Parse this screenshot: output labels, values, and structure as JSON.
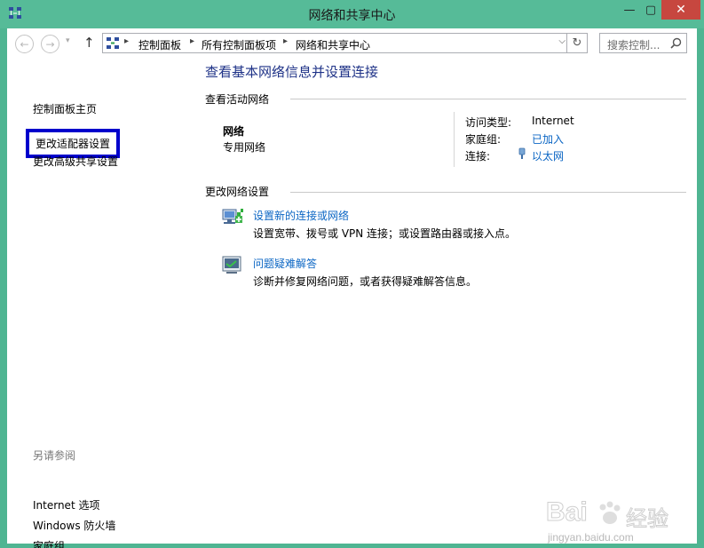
{
  "window": {
    "title": "网络和共享中心",
    "app_icon": "network-sharing-center-icon"
  },
  "titlebar_buttons": {
    "minimize": "—",
    "maximize": "▢",
    "close": "✕"
  },
  "navigation": {
    "back_glyph": "←",
    "forward_glyph": "→",
    "recent_glyph": "▾",
    "up_glyph": "↑",
    "breadcrumb": [
      "控制面板",
      "所有控制面板项",
      "网络和共享中心"
    ],
    "separator": "▸",
    "dropdown_glyph": "⌵",
    "refresh_glyph": "↻",
    "search_placeholder": "搜索控制..."
  },
  "sidebar": {
    "home": "控制面板主页",
    "change_adapter": "更改适配器设置",
    "change_sharing": "更改高级共享设置",
    "see_also": "另请参阅",
    "links": [
      "Internet 选项",
      "Windows 防火墙",
      "家庭组"
    ]
  },
  "main": {
    "title": "查看基本网络信息并设置连接",
    "active_networks_heading": "查看活动网络",
    "network": {
      "name": "网络",
      "category": "专用网络",
      "access_type_label": "访问类型:",
      "access_type": "Internet",
      "homegroup_label": "家庭组:",
      "homegroup": "已加入",
      "connections_label": "连接:",
      "connection": "以太网"
    },
    "change_settings_heading": "更改网络设置",
    "tasks": [
      {
        "icon": "setup-connection-icon",
        "link": "设置新的连接或网络",
        "desc": "设置宽带、拨号或 VPN 连接；或设置路由器或接入点。"
      },
      {
        "icon": "troubleshoot-icon",
        "link": "问题疑难解答",
        "desc": "诊断并修复网络问题，或者获得疑难解答信息。"
      }
    ]
  },
  "watermark": {
    "brand": "Bai",
    "brand_cn": "经验",
    "url": "jingyan.baidu.com"
  },
  "colors": {
    "frame": "#56bb98",
    "close": "#c7473f",
    "title_text": "#1e3287",
    "link": "#0b66c4",
    "highlight_box": "#0000cc"
  }
}
